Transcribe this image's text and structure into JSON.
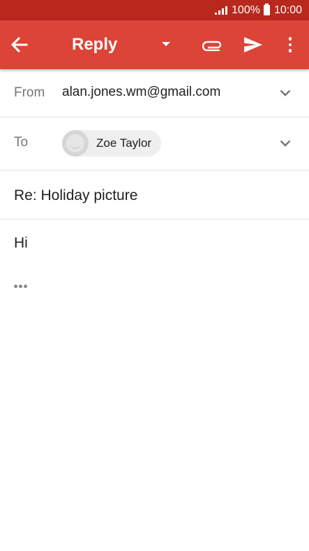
{
  "status_bar": {
    "battery_text": "100%",
    "time": "10:00",
    "icons": [
      "signal-icon",
      "battery-icon"
    ]
  },
  "app_bar": {
    "title": "Reply",
    "background": "#db4437",
    "icons": [
      "back-arrow-icon",
      "dropdown-arrow-icon",
      "attachment-icon",
      "send-icon",
      "more-vert-icon"
    ]
  },
  "from": {
    "label": "From",
    "value": "alan.jones.wm@gmail.com"
  },
  "to": {
    "label": "To",
    "recipient_name": "Zoe Taylor"
  },
  "subject": "Re: Holiday picture",
  "body": "Hi",
  "quoted_text_toggle": "•••"
}
